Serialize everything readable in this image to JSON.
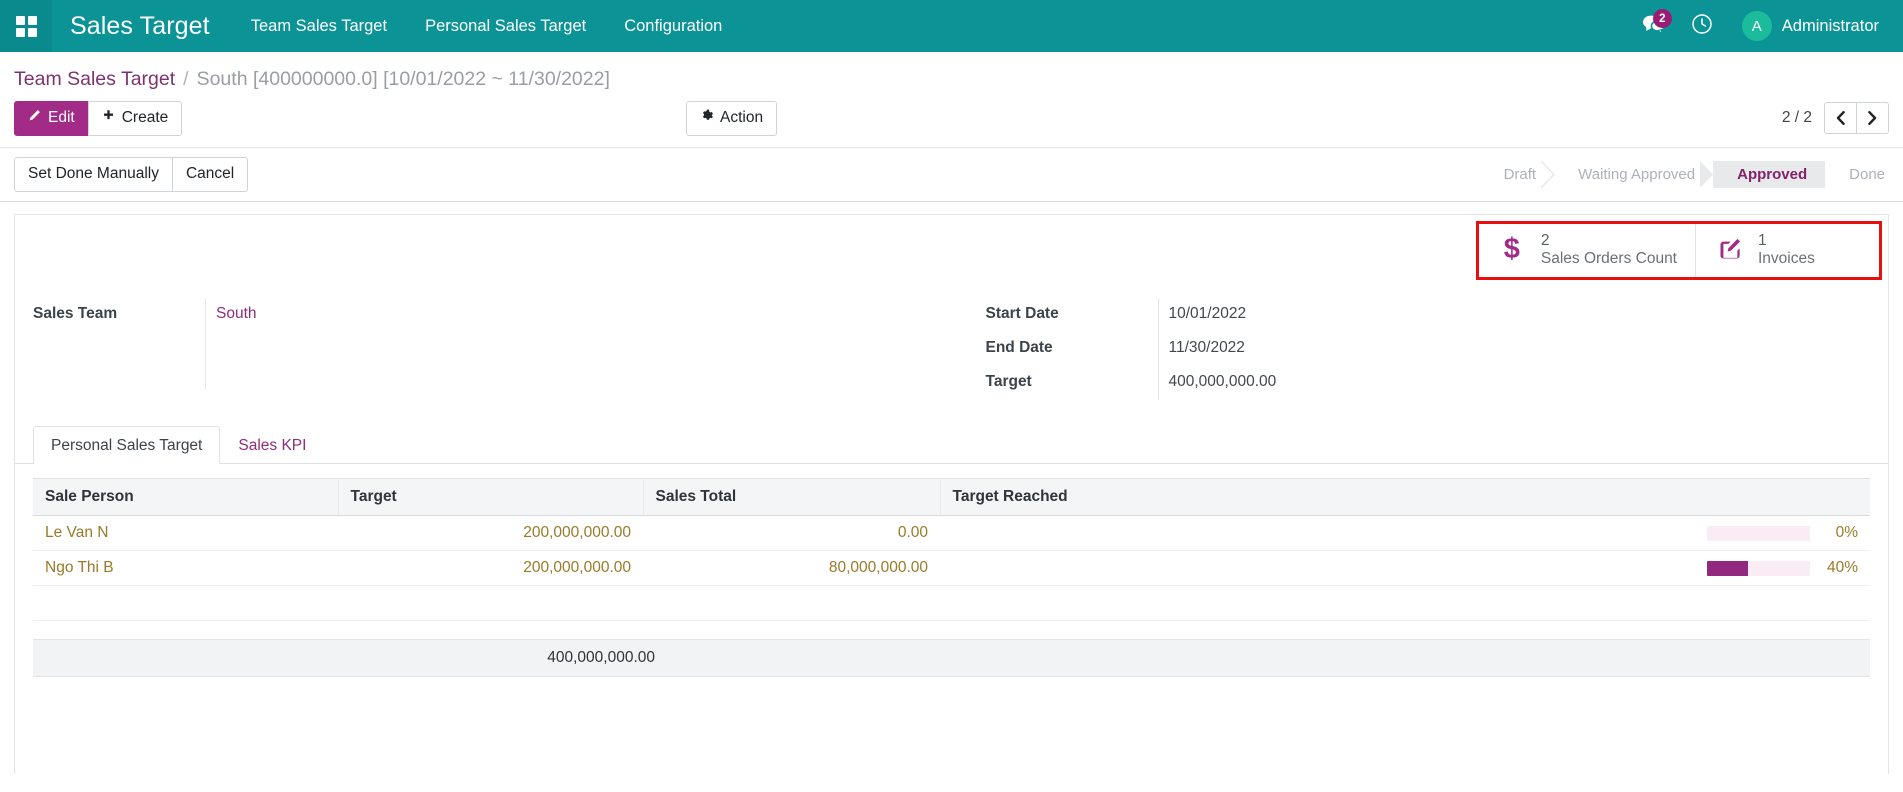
{
  "navbar": {
    "apps_icon": "apps-grid-icon",
    "brand": "Sales Target",
    "menu": [
      {
        "label": "Team Sales Target"
      },
      {
        "label": "Personal Sales Target"
      },
      {
        "label": "Configuration"
      }
    ],
    "messages_icon": "chat-bubble-icon",
    "messages_count": "2",
    "activity_icon": "clock-icon",
    "avatar_initial": "A",
    "user_name": "Administrator",
    "background_color": "#0c9396"
  },
  "breadcrumb": {
    "root": "Team Sales Target",
    "separator": "/",
    "current": "South [400000000.0] [10/01/2022 ~ 11/30/2022]"
  },
  "control_panel": {
    "edit_label": "Edit",
    "edit_icon": "pencil-icon",
    "create_label": "Create",
    "create_icon": "plus-icon",
    "action_label": "Action",
    "action_icon": "gear-icon",
    "pager_text": "2 / 2",
    "prev_icon": "chevron-left-icon",
    "next_icon": "chevron-right-icon"
  },
  "statusbar": {
    "buttons": [
      {
        "label": "Set Done Manually"
      },
      {
        "label": "Cancel"
      }
    ],
    "stages": [
      {
        "label": "Draft",
        "active": false
      },
      {
        "label": "Waiting Approved",
        "active": false
      },
      {
        "label": "Approved",
        "active": true
      },
      {
        "label": "Done",
        "active": false
      }
    ],
    "active_color": "#84216b"
  },
  "stat_buttons": {
    "highlight_color": "#e8100f",
    "items": [
      {
        "icon": "dollar-icon",
        "value": "2",
        "label": "Sales Orders Count"
      },
      {
        "icon": "pencil-square-icon",
        "value": "1",
        "label": "Invoices"
      }
    ]
  },
  "form": {
    "left": [
      {
        "label": "Sales Team",
        "value": "South",
        "is_link": true
      }
    ],
    "right": [
      {
        "label": "Start Date",
        "value": "10/01/2022",
        "is_link": false
      },
      {
        "label": "End Date",
        "value": "11/30/2022",
        "is_link": false
      },
      {
        "label": "Target",
        "value": "400,000,000.00",
        "is_link": false
      }
    ]
  },
  "notebook": {
    "tabs": [
      {
        "label": "Personal Sales Target",
        "active": true
      },
      {
        "label": "Sales KPI",
        "active": false
      }
    ]
  },
  "table": {
    "columns": [
      "Sale Person",
      "Target",
      "Sales Total",
      "",
      "Target Reached"
    ],
    "rows": [
      {
        "sale_person": "Le Van N",
        "target": "200,000,000.00",
        "sales_total": "0.00",
        "percent_label": "0%",
        "percent_value": 0
      },
      {
        "sale_person": "Ngo Thi B",
        "target": "200,000,000.00",
        "sales_total": "80,000,000.00",
        "percent_label": "40%",
        "percent_value": 40
      }
    ],
    "footer_total": "400,000,000.00"
  }
}
